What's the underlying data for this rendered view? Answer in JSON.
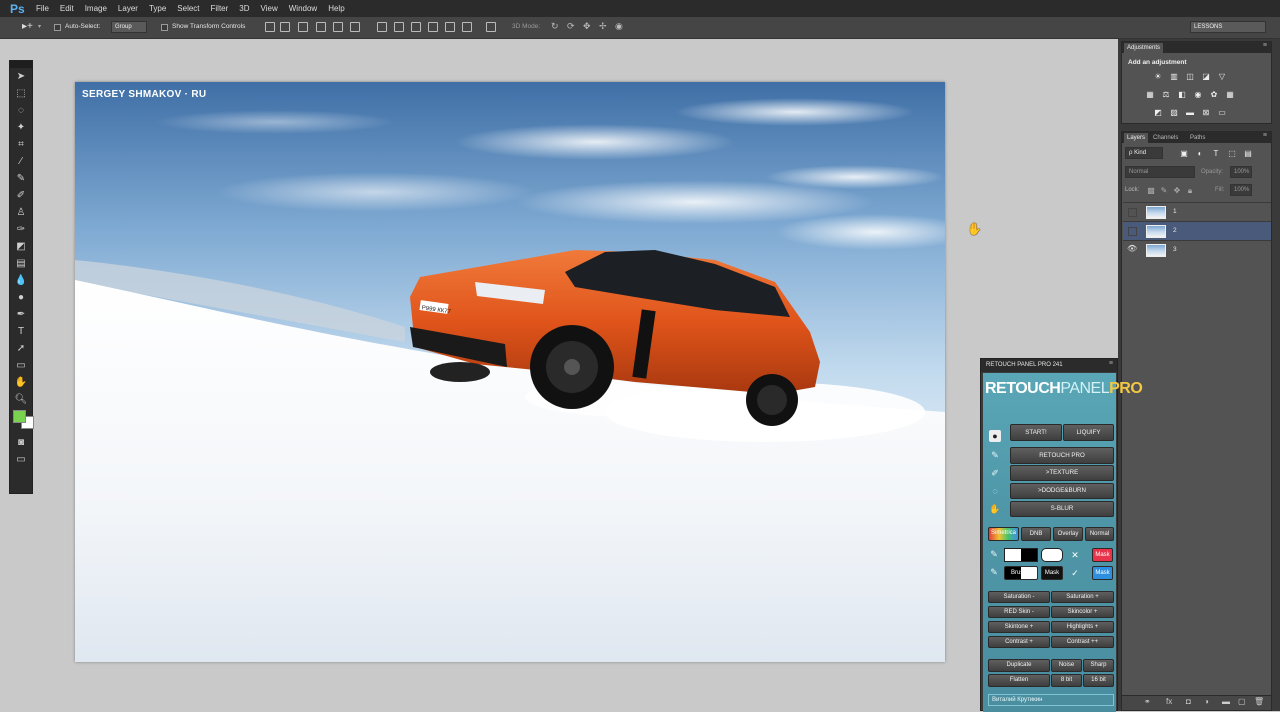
{
  "menubar": {
    "logo": "Ps",
    "items": [
      "File",
      "Edit",
      "Image",
      "Layer",
      "Type",
      "Select",
      "Filter",
      "3D",
      "View",
      "Window",
      "Help"
    ]
  },
  "options": {
    "auto_select_label": "Auto-Select:",
    "auto_select_value": "Group",
    "show_transform_label": "Show Transform Controls",
    "mode_3d_label": "3D Mode:",
    "workspace_value": "LESSONS"
  },
  "canvas": {
    "watermark": "SERGEY SHMAKOV · RU",
    "plate": "Р999 КК77"
  },
  "adjustments": {
    "tab": "Adjustments",
    "heading": "Add an adjustment"
  },
  "layers_panel": {
    "tabs": [
      "Layers",
      "Channels",
      "Paths"
    ],
    "kind_label": "ρ Kind",
    "blend_mode": "Normal",
    "opacity_label": "Opacity:",
    "opacity_value": "100%",
    "lock_label": "Lock:",
    "fill_label": "Fill:",
    "fill_value": "100%",
    "layers": [
      {
        "name": "1",
        "visible": false,
        "selected": false
      },
      {
        "name": "2",
        "visible": false,
        "selected": true
      },
      {
        "name": "3",
        "visible": true,
        "selected": false
      }
    ]
  },
  "retouch_panel": {
    "title": "RETOUCH PANEL PRO 241",
    "logo_a": "RETOUCH",
    "logo_b": "PANEL",
    "logo_c": "PRO",
    "start": "START!",
    "liquify": "LIQUIFY",
    "main_buttons": [
      "RETOUCH PRO",
      ">TEXTURE",
      ">DODGE&BURN",
      "S-BLUR"
    ],
    "mode_row": [
      "Simetrica",
      "DNB",
      "Overlay",
      "Normal"
    ],
    "brush_label": "Brush",
    "mask_label": "Mask",
    "adjust_grid": [
      [
        "Saturation -",
        "Saturation +"
      ],
      [
        "RED Skin -",
        "Skincolor +"
      ],
      [
        "Skintone +",
        "Highlights +"
      ],
      [
        "Contrast +",
        "Contrast ++"
      ]
    ],
    "duplicate": "Duplicate",
    "noise": "Noise",
    "sharp": "Sharp",
    "flatten": "Flatten",
    "bit8": "8 bit",
    "bit16": "16 bit",
    "author": "Виталий Крутикин"
  },
  "colors": {
    "foreground": "#7ad34f",
    "background": "#ffffff",
    "car": "#e2561a",
    "panel_teal": "#4f97a8",
    "selected_layer": "#4a5a7a"
  }
}
